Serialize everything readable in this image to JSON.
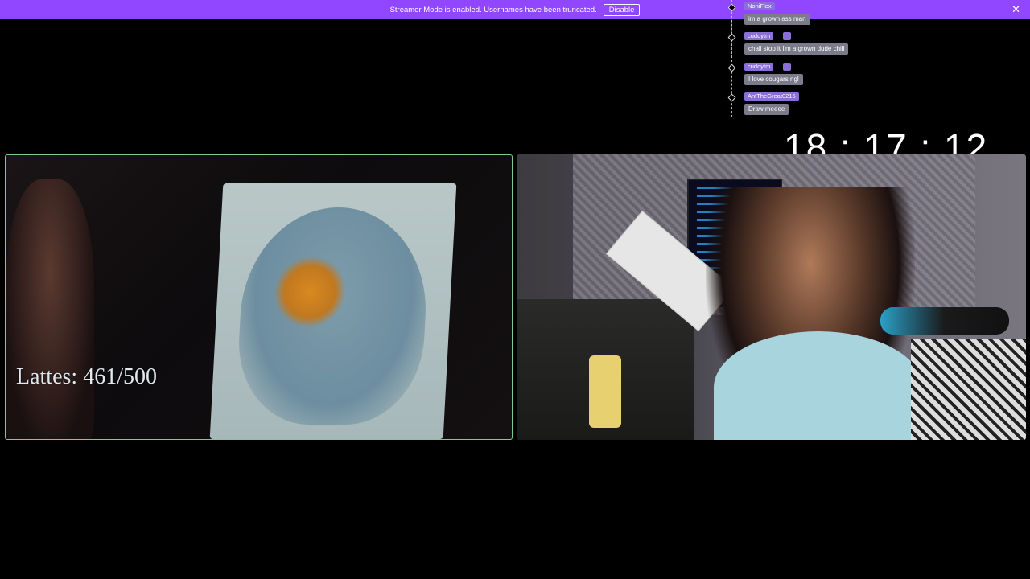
{
  "banner": {
    "message": "Streamer Mode is enabled. Usernames have been truncated.",
    "disable_label": "Disable",
    "close_label": "✕"
  },
  "chat": {
    "messages": [
      {
        "user": "NoniFlex",
        "text": "im a grown ass man"
      },
      {
        "user": "cuddytm",
        "text": "chall stop it I'm a grown dude chill"
      },
      {
        "user": "cuddytm",
        "text": "I love cougars ngl"
      },
      {
        "user": "AntTheGreat0215",
        "text": "Draw meeee"
      }
    ]
  },
  "timer": {
    "text": "18 : 17 : 12"
  },
  "overlay": {
    "lattes": "Lattes: 461/500"
  },
  "colors": {
    "banner": "#9147ff",
    "username_badge": "#8a6fd6",
    "panel_border": "#7ecb8f"
  }
}
